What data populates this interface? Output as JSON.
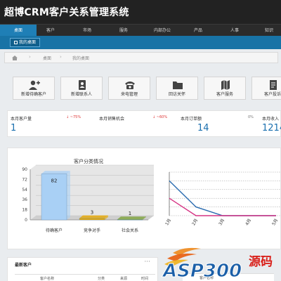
{
  "app": {
    "title": "超博CRM客户关系管理系统"
  },
  "nav": {
    "items": [
      "桌面",
      "客户",
      "市场",
      "服务",
      "内部办公",
      "产品",
      "人事",
      "知识"
    ]
  },
  "subnav": {
    "tab": "我的桌面"
  },
  "breadcrumb": [
    "桌面",
    "我的桌面"
  ],
  "quick_actions": [
    "新增待确客户",
    "新增联系人",
    "来电管理",
    "回访关怀",
    "客户服务",
    "客户投诉"
  ],
  "stats": [
    {
      "label": "本月客户量",
      "delta": "~75%",
      "value": "1"
    },
    {
      "label": "本月销售机会",
      "delta": "~60%",
      "value": ""
    },
    {
      "label": "本月订单额",
      "delta": "0%",
      "value": "14"
    },
    {
      "label": "本月收入",
      "delta": "",
      "value": "1214"
    }
  ],
  "chart_data": [
    {
      "type": "bar",
      "title": "客户分类情况",
      "categories": [
        "待确客户",
        "竞争对手",
        "社会关系"
      ],
      "values": [
        82,
        3,
        1
      ],
      "ylim": [
        0,
        90
      ],
      "yticks": [
        0,
        18,
        36,
        54,
        72,
        90
      ],
      "colors": [
        "#a9d0f5",
        "#e8a800",
        "#7ea23b"
      ]
    },
    {
      "type": "line",
      "categories": [
        "1月",
        "2月",
        "3月",
        "4月",
        "5月"
      ],
      "series": [
        {
          "values": [
            4,
            1,
            0,
            0,
            0
          ],
          "color": "#2b6cb0"
        },
        {
          "values": [
            2,
            0,
            0,
            0,
            0
          ],
          "color": "#d63384"
        }
      ],
      "ylim": [
        0,
        5
      ]
    }
  ],
  "recent": {
    "title": "最新客户",
    "more": "···",
    "columns": [
      "客户名称",
      "分类",
      "来源",
      "时间"
    ],
    "columns2": [
      "客户名称"
    ]
  },
  "watermark": {
    "text": "ASP300",
    "sub": "源码"
  }
}
